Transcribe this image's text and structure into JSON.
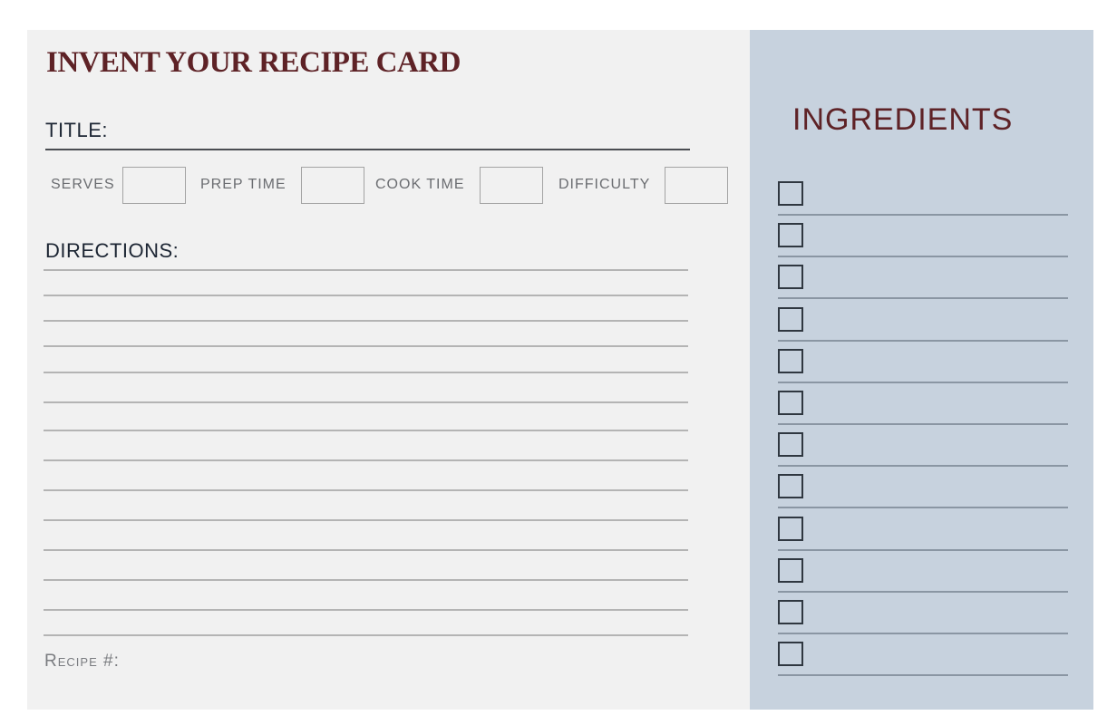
{
  "card": {
    "heading": "INVENT YOUR RECIPE CARD",
    "title_label": "TITLE:",
    "title_value": "",
    "meta": [
      {
        "label": "SERVES",
        "value": ""
      },
      {
        "label": "PREP TIME",
        "value": ""
      },
      {
        "label": "COOK TIME",
        "value": ""
      },
      {
        "label": "DIFFICULTY",
        "value": ""
      }
    ],
    "directions_label": "DIRECTIONS:",
    "directions_line_count": 14,
    "recipe_number_label": "Recipe #:"
  },
  "ingredients": {
    "heading": "INGREDIENTS",
    "item_count": 12,
    "items": [
      "",
      "",
      "",
      "",
      "",
      "",
      "",
      "",
      "",
      "",
      "",
      ""
    ]
  },
  "colors": {
    "accent": "#5e2226",
    "card_background": "#f1f1f1",
    "ingredients_panel": "#c7d2de"
  }
}
